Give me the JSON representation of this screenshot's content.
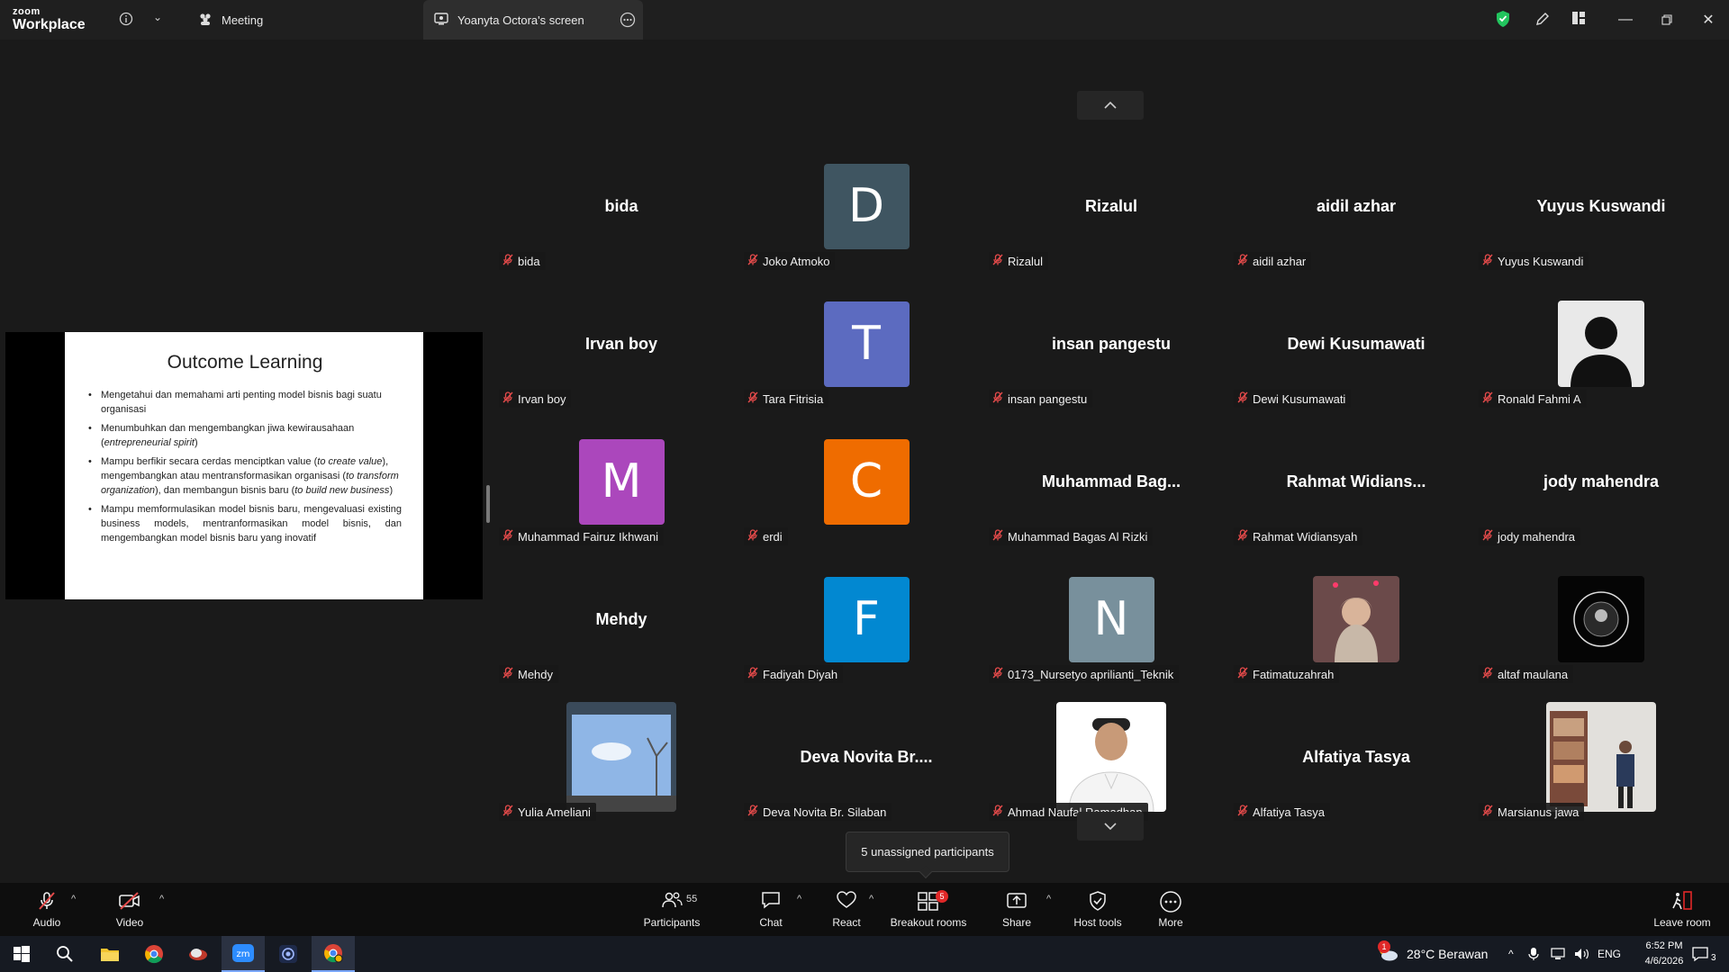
{
  "topbar": {
    "brand_top": "zoom",
    "brand_bottom": "Workplace",
    "info_icon": "info-icon",
    "meeting_tab": "Meeting",
    "screen_tab": "Yoanyta Octora's screen"
  },
  "slide": {
    "title": "Outcome Learning",
    "b1": "Mengetahui dan memahami arti penting model bisnis bagi suatu organisasi",
    "b2a": "Menumbuhkan dan mengembangkan jiwa kewirausahaan (",
    "b2i": "entrepreneurial spirit",
    "b2b": ")",
    "b3a": "Mampu berfikir secara cerdas menciptkan value (",
    "b3i1": "to create value",
    "b3b": "), mengembangkan atau mentransformasikan organisasi (",
    "b3i2": "to transform organization",
    "b3c": "), dan membangun bisnis baru (",
    "b3i3": "to build new business",
    "b3d": ")",
    "b4": "Mampu memformulasikan model bisnis baru, mengevaluasi existing business models, mentranformasikan model bisnis, dan mengembangkan model bisnis baru yang inovatif"
  },
  "participants": [
    {
      "display": "bida",
      "label": "bida"
    },
    {
      "display": "D",
      "label": "Joko Atmoko",
      "color": "#3f5561"
    },
    {
      "display": "Rizalul",
      "label": "Rizalul"
    },
    {
      "display": "aidil azhar",
      "label": "aidil azhar"
    },
    {
      "display": "Yuyus Kuswandi",
      "label": "Yuyus Kuswandi"
    },
    {
      "display": "Irvan boy",
      "label": "Irvan boy"
    },
    {
      "display": "T",
      "label": "Tara Fitrisia",
      "color": "#5c6bc0"
    },
    {
      "display": "insan pangestu",
      "label": "insan pangestu"
    },
    {
      "display": "Dewi Kusumawati",
      "label": "Dewi Kusumawati"
    },
    {
      "display": "",
      "label": "Ronald Fahmi A"
    },
    {
      "display": "M",
      "label": "Muhammad Fairuz Ikhwani",
      "color": "#ab47bc"
    },
    {
      "display": "C",
      "label": "erdi",
      "color": "#ef6c00"
    },
    {
      "display": "Muhammad  Bag...",
      "label": "Muhammad Bagas Al Rizki"
    },
    {
      "display": "Rahmat  Widians...",
      "label": "Rahmat Widiansyah"
    },
    {
      "display": "jody mahendra",
      "label": "jody mahendra"
    },
    {
      "display": "Mehdy",
      "label": "Mehdy"
    },
    {
      "display": "F",
      "label": "Fadiyah Diyah",
      "color": "#0288d1"
    },
    {
      "display": "N",
      "label": "0173_Nursetyo aprilianti_Teknik",
      "color": "#78909c"
    },
    {
      "display": "",
      "label": "Fatimatuzahrah"
    },
    {
      "display": "",
      "label": "altaf maulana"
    },
    {
      "display": "",
      "label": "Yulia Ameliani"
    },
    {
      "display": "Deva  Novita  Br....",
      "label": "Deva Novita Br. Silaban"
    },
    {
      "display": "",
      "label": "Ahmad Naufal Ramadhan"
    },
    {
      "display": "Alfatiya Tasya",
      "label": "Alfatiya Tasya"
    },
    {
      "display": "",
      "label": "Marsianus jawa"
    }
  ],
  "tooltip": "5 unassigned participants",
  "toolbar": {
    "audio": "Audio",
    "video": "Video",
    "participants": "Participants",
    "participants_count": "55",
    "chat": "Chat",
    "react": "React",
    "breakout": "Breakout rooms",
    "breakout_badge": "5",
    "share": "Share",
    "host_tools": "Host tools",
    "more": "More",
    "leave": "Leave room"
  },
  "taskbar": {
    "weather": "28°C  Berawan",
    "weather_badge": "1",
    "lang": "ENG",
    "time": "6:52 PM",
    "date": "4/6/2026",
    "notif": "3"
  },
  "colors": {
    "mic_off": "#e64b4b",
    "shield": "#22c55e",
    "badge": "#e02828"
  }
}
